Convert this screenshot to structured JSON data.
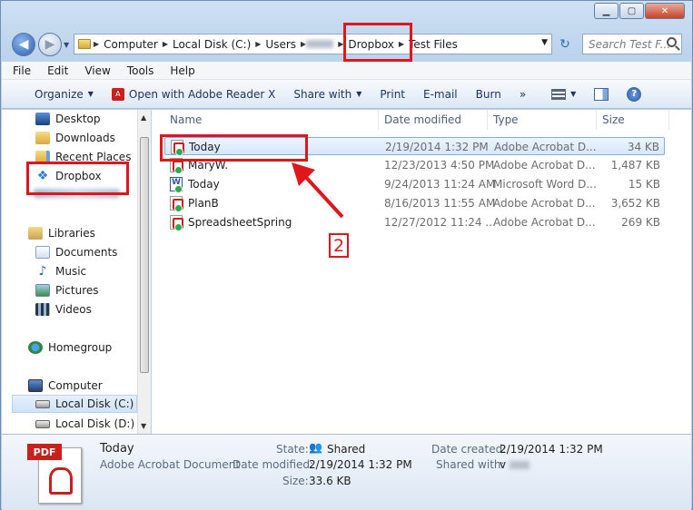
{
  "window": {
    "controls": {
      "minimize": "▁",
      "maximize": "▢",
      "close": "✕"
    }
  },
  "address": {
    "segments": [
      "Computer",
      "Local Disk (C:)",
      "Users",
      "Dropbox",
      "Test Files"
    ],
    "search_placeholder": "Search Test F..."
  },
  "menu": [
    "File",
    "Edit",
    "View",
    "Tools",
    "Help"
  ],
  "toolbar": {
    "organize": "Organize",
    "open_with": "Open with Adobe Reader X",
    "share_with": "Share with",
    "print": "Print",
    "email": "E-mail",
    "burn": "Burn",
    "more": "»"
  },
  "nav": {
    "desktop": "Desktop",
    "downloads": "Downloads",
    "recent": "Recent Places",
    "dropbox": "Dropbox",
    "libraries": "Libraries",
    "documents": "Documents",
    "music": "Music",
    "pictures": "Pictures",
    "videos": "Videos",
    "homegroup": "Homegroup",
    "computer": "Computer",
    "local_c": "Local Disk (C:)",
    "local_d": "Local Disk (D:)"
  },
  "columns": {
    "name": "Name",
    "date": "Date modified",
    "type": "Type",
    "size": "Size"
  },
  "files": [
    {
      "name": "Today",
      "date": "2/19/2014 1:32 PM",
      "type": "Adobe Acrobat D...",
      "size": "34 KB",
      "icon": "pdf-icon"
    },
    {
      "name": "MaryW.",
      "date": "12/23/2013 4:50 PM",
      "type": "Adobe Acrobat D...",
      "size": "1,487 KB",
      "icon": "pdf-icon"
    },
    {
      "name": "Today",
      "date": "9/24/2013 11:24 AM",
      "type": "Microsoft Word D...",
      "size": "15 KB",
      "icon": "word-icon"
    },
    {
      "name": "PlanB",
      "date": "8/16/2013 11:55 AM",
      "type": "Adobe Acrobat D...",
      "size": "3,652 KB",
      "icon": "pdf-icon"
    },
    {
      "name": "SpreadsheetSpring",
      "date": "12/27/2012 11:24 ...",
      "type": "Adobe Acrobat D...",
      "size": "269 KB",
      "icon": "pdf-icon"
    }
  ],
  "annotation": {
    "step": "2"
  },
  "details": {
    "badge": "PDF",
    "name": "Today",
    "type": "Adobe Acrobat Document",
    "state_label": "State:",
    "state_value": "Shared",
    "modified_label": "Date modified:",
    "modified_value": "2/19/2014 1:32 PM",
    "size_label": "Size:",
    "size_value": "33.6 KB",
    "created_label": "Date created:",
    "created_value": "2/19/2014 1:32 PM",
    "shared_label": "Shared with:",
    "shared_value": "v"
  },
  "colors": {
    "highlight": "#e0161c",
    "accent": "#2a6bc4"
  }
}
